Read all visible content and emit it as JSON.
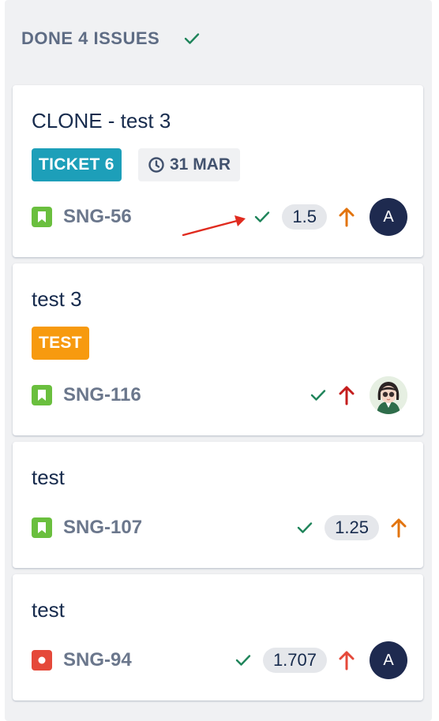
{
  "column": {
    "title": "DONE 4 ISSUES",
    "status_color": "#1f845a"
  },
  "cards": [
    {
      "title": "CLONE - test 3",
      "labels": [
        {
          "text": "TICKET 6",
          "color": "#1d9fb9"
        }
      ],
      "due_date": "31 MAR",
      "type_icon": "story-icon",
      "type_color": "#6abf3e",
      "key": "SNG-56",
      "done": true,
      "estimate": "1.5",
      "priority_icon": "arrow-up-icon",
      "priority_color": "#e2740f",
      "assignee_initial": "A"
    },
    {
      "title": "test 3",
      "labels": [
        {
          "text": "TEST",
          "color": "#f79a0f"
        }
      ],
      "type_icon": "story-icon",
      "type_color": "#6abf3e",
      "key": "SNG-116",
      "done": true,
      "priority_icon": "arrow-up-icon",
      "priority_color": "#c41e1e",
      "assignee_avatar": "avatar-cartoon-girl"
    },
    {
      "title": "test",
      "type_icon": "story-icon",
      "type_color": "#6abf3e",
      "key": "SNG-107",
      "done": true,
      "estimate": "1.25",
      "priority_icon": "arrow-up-icon",
      "priority_color": "#e2740f"
    },
    {
      "title": "test",
      "type_icon": "bug-icon",
      "type_color": "#e5493a",
      "key": "SNG-94",
      "done": true,
      "estimate": "1.707",
      "priority_icon": "arrow-up-icon",
      "priority_color": "#e5493a",
      "assignee_initial": "A"
    }
  ],
  "annotation": {
    "icon": "red-annotation-arrow-icon",
    "color": "#e02b1f"
  }
}
